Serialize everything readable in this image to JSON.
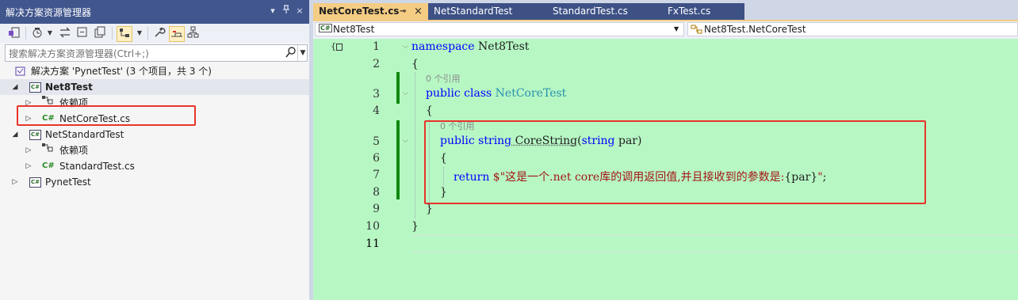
{
  "solution_explorer": {
    "title": "解决方案资源管理器",
    "title_buttons": [
      "▾",
      "ᵖ",
      "×"
    ],
    "search_placeholder": "搜索解决方案资源管理器(Ctrl+;)",
    "tree": {
      "solution": "解决方案 'PynetTest' (3 个项目，共 3 个)",
      "projects": [
        {
          "name": "Net8Test",
          "children": [
            "依赖项",
            "NetCoreTest.cs"
          ]
        },
        {
          "name": "NetStandardTest",
          "children": [
            "依赖项",
            "StandardTest.cs"
          ]
        },
        {
          "name": "PynetTest"
        }
      ]
    },
    "icon_text": {
      "cs": "C#",
      "csproj": "C#"
    }
  },
  "editor": {
    "tabs": [
      {
        "label": "NetCoreTest.cs",
        "pin": "⊸",
        "close": "×",
        "active": true
      },
      {
        "label": "NetStandardTest"
      },
      {
        "label": "StandardTest.cs"
      },
      {
        "label": "FxTest.cs"
      }
    ],
    "nav": {
      "project": "Net8Test",
      "member": "Net8Test.NetCoreTest",
      "badge": "C#"
    },
    "refs_label": "0 个引用",
    "code": {
      "l1_kw": "namespace",
      "l1_name": " Net8Test",
      "l2": "{",
      "l3_kw": "public class",
      "l3_type": " NetCoreTest",
      "l4": "{",
      "l5_kw1": "public string",
      "l5_name": " CoreString",
      "l5_open": "(",
      "l5_kw2": "string",
      "l5_par": " par)",
      "l6": "{",
      "l7_kw": "return",
      "l7_str1": " $\"这是一个.net core库的调用返回值,并且接收到的参数是:",
      "l7_interp": "{par}",
      "l7_str2": "\"",
      "l7_semi": ";",
      "l8": "}",
      "l9": "}",
      "l10": "}"
    },
    "line_numbers": [
      "1",
      "2",
      "3",
      "4",
      "5",
      "6",
      "7",
      "8",
      "9",
      "10",
      "11"
    ]
  },
  "colors": {
    "accent": "#40568d",
    "active_tab": "#f5cc84",
    "editor_bg": "#b7f7c4",
    "highlight_box": "#e8342b"
  }
}
